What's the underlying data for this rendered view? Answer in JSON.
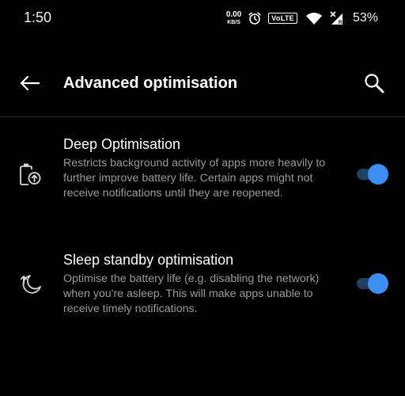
{
  "status_bar": {
    "time": "1:50",
    "net_speed_value": "0.00",
    "net_speed_unit": "KB/S",
    "volte_label": "VoLTE",
    "battery_percent": "53%"
  },
  "toolbar": {
    "title": "Advanced optimisation"
  },
  "settings": [
    {
      "title": "Deep Optimisation",
      "description": "Restricts background activity of apps more heavily to further improve battery life. Certain apps might not receive notifications until they are reopened.",
      "enabled": true
    },
    {
      "title": "Sleep standby optimisation",
      "description": "Optimise the battery life (e.g. disabling the network) when you're asleep. This will make apps unable to receive timely notifications.",
      "enabled": true
    }
  ],
  "colors": {
    "background": "#000000",
    "accent": "#3d8ef0",
    "secondary_text": "#9a9a9a"
  }
}
